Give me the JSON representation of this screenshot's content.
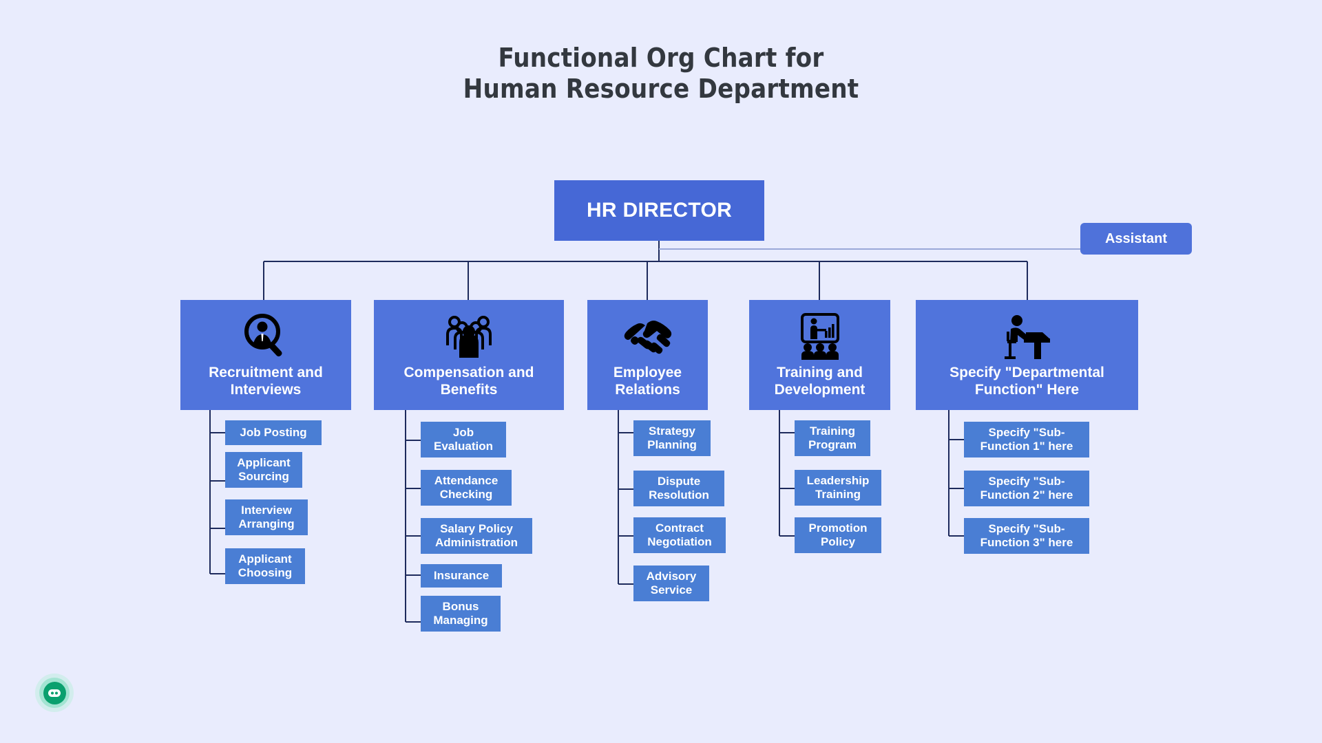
{
  "page": {
    "background_color": "#e9ecfd",
    "title_lines": [
      "Functional Org Chart for",
      "Human Resource Department"
    ],
    "title_color": "#33383f"
  },
  "colors": {
    "root_box": "#4668d6",
    "dept_box": "#5074dc",
    "sub_box": "#4a7ed4",
    "assistant_box": "#4f72da",
    "connector": "#1d2a5c",
    "text": "#ffffff",
    "badge_green": "#0aa06e"
  },
  "chart_data": {
    "type": "diagram",
    "diagram_type": "organizational-chart",
    "title": "Functional Org Chart for Human Resource Department",
    "root": {
      "label": "HR DIRECTOR",
      "level": 0
    },
    "staff": [
      {
        "label": "Assistant",
        "level": "staff",
        "attaches_to": "HR DIRECTOR"
      }
    ],
    "departments": [
      {
        "label": "Recruitment and Interviews",
        "icon": "person-search-icon",
        "children": [
          "Job Posting",
          "Applicant Sourcing",
          "Interview Arranging",
          "Applicant Choosing"
        ]
      },
      {
        "label": "Compensation and Benefits",
        "icon": "people-group-icon",
        "children": [
          "Job Evaluation",
          "Attendance Checking",
          "Salary Policy Administration",
          "Insurance",
          "Bonus Managing"
        ]
      },
      {
        "label": "Employee Relations",
        "icon": "handshake-icon",
        "children": [
          "Strategy Planning",
          "Dispute Resolution",
          "Contract Negotiation",
          "Advisory Service"
        ]
      },
      {
        "label": "Training and Development",
        "icon": "presentation-training-icon",
        "children": [
          "Training Program",
          "Leadership Training",
          "Promotion Policy"
        ]
      },
      {
        "label": "Specify \"Departmental Function\" Here",
        "icon": "desk-worker-icon",
        "children": [
          "Specify \"Sub-Function 1\" here",
          "Specify \"Sub-Function 2\" here",
          "Specify \"Sub-Function 3\" here"
        ]
      }
    ]
  },
  "nodes": {
    "root": {
      "label": "HR DIRECTOR"
    },
    "assistant": {
      "label": "Assistant"
    },
    "dept": [
      {
        "label_line1": "Recruitment and",
        "label_line2": "Interviews"
      },
      {
        "label_line1": "Compensation and",
        "label_line2": "Benefits"
      },
      {
        "label_line1": "Employee",
        "label_line2": "Relations"
      },
      {
        "label_line1": "Training and",
        "label_line2": "Development"
      },
      {
        "label_line1": "Specify \"Departmental",
        "label_line2": "Function\" Here"
      }
    ],
    "sub": {
      "col1": [
        {
          "line1": "Job Posting",
          "line2": ""
        },
        {
          "line1": "Applicant",
          "line2": "Sourcing"
        },
        {
          "line1": "Interview",
          "line2": "Arranging"
        },
        {
          "line1": "Applicant",
          "line2": "Choosing"
        }
      ],
      "col2": [
        {
          "line1": "Job",
          "line2": "Evaluation"
        },
        {
          "line1": "Attendance",
          "line2": "Checking"
        },
        {
          "line1": "Salary Policy",
          "line2": "Administration"
        },
        {
          "line1": "Insurance",
          "line2": ""
        },
        {
          "line1": "Bonus",
          "line2": "Managing"
        }
      ],
      "col3": [
        {
          "line1": "Strategy",
          "line2": "Planning"
        },
        {
          "line1": "Dispute",
          "line2": "Resolution"
        },
        {
          "line1": "Contract",
          "line2": "Negotiation"
        },
        {
          "line1": "Advisory",
          "line2": "Service"
        }
      ],
      "col4": [
        {
          "line1": "Training",
          "line2": "Program"
        },
        {
          "line1": "Leadership",
          "line2": "Training"
        },
        {
          "line1": "Promotion",
          "line2": "Policy"
        }
      ],
      "col5": [
        {
          "line1": "Specify \"Sub-",
          "line2": "Function 1\" here"
        },
        {
          "line1": "Specify \"Sub-",
          "line2": "Function 2\" here"
        },
        {
          "line1": "Specify \"Sub-",
          "line2": "Function 3\" here"
        }
      ]
    }
  },
  "badge": {
    "name": "bot-assistant-badge"
  }
}
